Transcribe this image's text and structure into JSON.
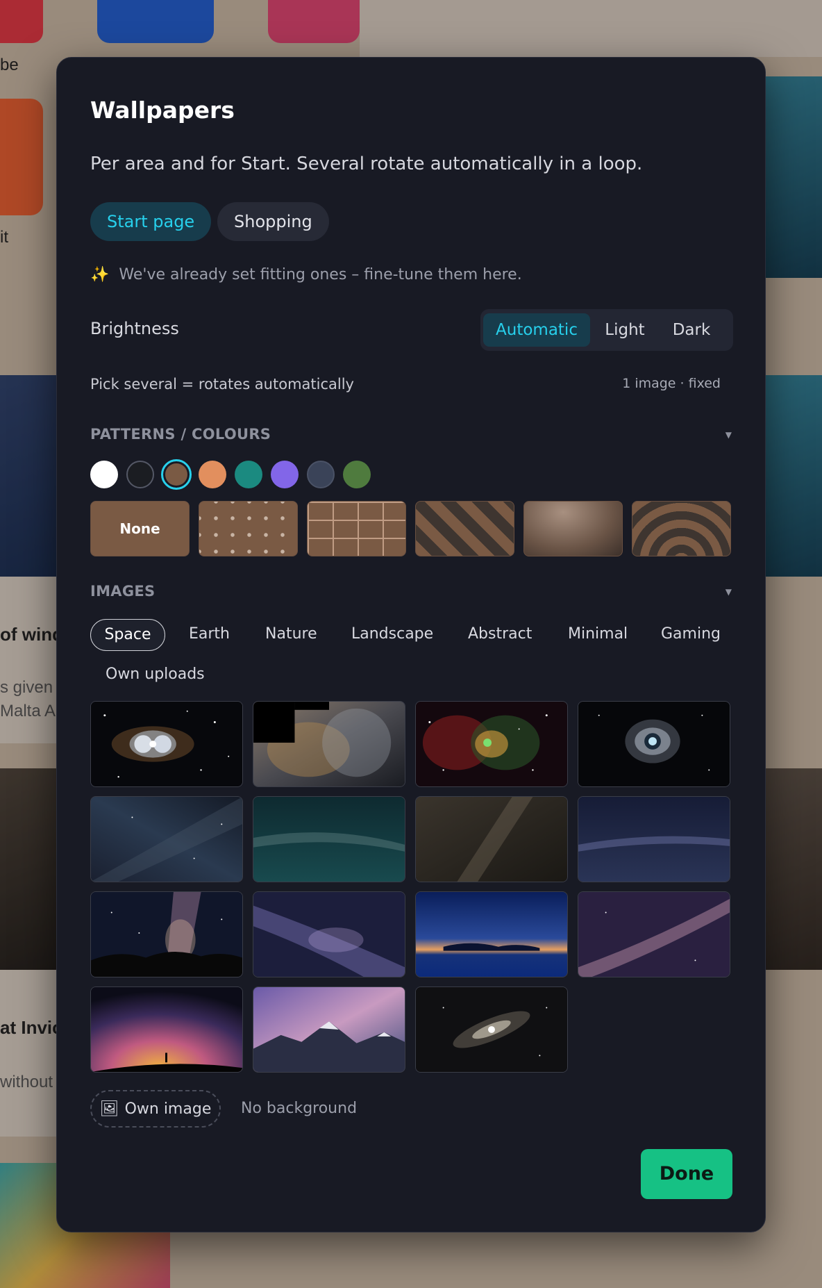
{
  "background_page": {
    "texts": [
      "be",
      "it",
      "of wind",
      "s given r",
      "Malta A",
      "at Invic",
      "without"
    ]
  },
  "modal": {
    "title": "Wallpapers",
    "subtitle": "Per area and for Start. Several rotate automatically in a loop.",
    "area_tabs": [
      {
        "label": "Start page",
        "active": true
      },
      {
        "label": "Shopping",
        "active": false
      }
    ],
    "hint": "We've already set fitting ones – fine-tune them here.",
    "hint_icon": "sparkles-icon",
    "brightness": {
      "label": "Brightness",
      "options": [
        "Automatic",
        "Light",
        "Dark"
      ],
      "selected": "Automatic"
    },
    "pick_label": "Pick several = rotates automatically",
    "pick_info": "1 image · fixed",
    "patterns": {
      "heading": "PATTERNS / COLOURS",
      "swatches": [
        "#ffffff",
        "#1b1d22",
        "#7a5a44",
        "#e28f5e",
        "#1b8a80",
        "#8266e8",
        "#3a4358",
        "#4f7b3e"
      ],
      "selected_swatch": "#7a5a44",
      "tiles": [
        "None",
        "dots",
        "grid",
        "stripes",
        "gradient",
        "rings"
      ],
      "none_label": "None"
    },
    "images": {
      "heading": "IMAGES",
      "categories": [
        "Space",
        "Earth",
        "Nature",
        "Landscape",
        "Abstract",
        "Minimal",
        "Gaming",
        "Own uploads"
      ],
      "selected_category": "Space",
      "thumbnail_count": 15
    },
    "own_image_label": "Own image",
    "own_image_icon": "image-frame-icon",
    "no_background_label": "No background",
    "done_label": "Done",
    "colors": {
      "modal_bg": "#181a24",
      "accent": "#27d0ec",
      "accent_bg": "#173c4c",
      "done_bg": "#16c184"
    }
  }
}
